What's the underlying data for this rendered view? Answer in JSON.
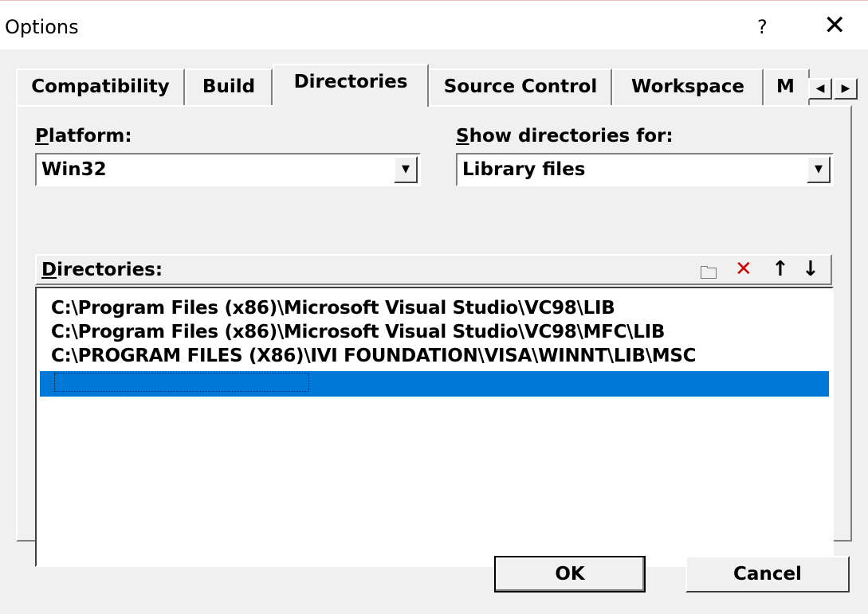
{
  "window": {
    "title": "Options",
    "help_label": "?",
    "close_label": "✕"
  },
  "tabs": [
    {
      "label": "Compatibility"
    },
    {
      "label": "Build"
    },
    {
      "label": "Directories"
    },
    {
      "label": "Source Control"
    },
    {
      "label": "Workspace"
    },
    {
      "label": "M"
    }
  ],
  "tab_scroll": {
    "left": "◀",
    "right": "▶"
  },
  "platform": {
    "label_u": "P",
    "label_rest": "latform:",
    "value": "Win32"
  },
  "show_dirs": {
    "label_u": "S",
    "label_rest": "how directories for:",
    "value": "Library files"
  },
  "directories": {
    "label_u": "D",
    "label_rest": "irectories:",
    "icons": {
      "new": "new-folder-icon",
      "delete": "delete-icon",
      "up": "move-up-icon",
      "down": "move-down-icon"
    },
    "entries": [
      "C:\\Program Files (x86)\\Microsoft Visual Studio\\VC98\\LIB",
      "C:\\Program Files (x86)\\Microsoft Visual Studio\\VC98\\MFC\\LIB",
      "C:\\PROGRAM FILES (X86)\\IVI FOUNDATION\\VISA\\WINNT\\LIB\\MSC"
    ]
  },
  "buttons": {
    "ok": "OK",
    "cancel": "Cancel"
  },
  "colors": {
    "selection": "#0078d7",
    "delete_icon": "#d00000"
  }
}
